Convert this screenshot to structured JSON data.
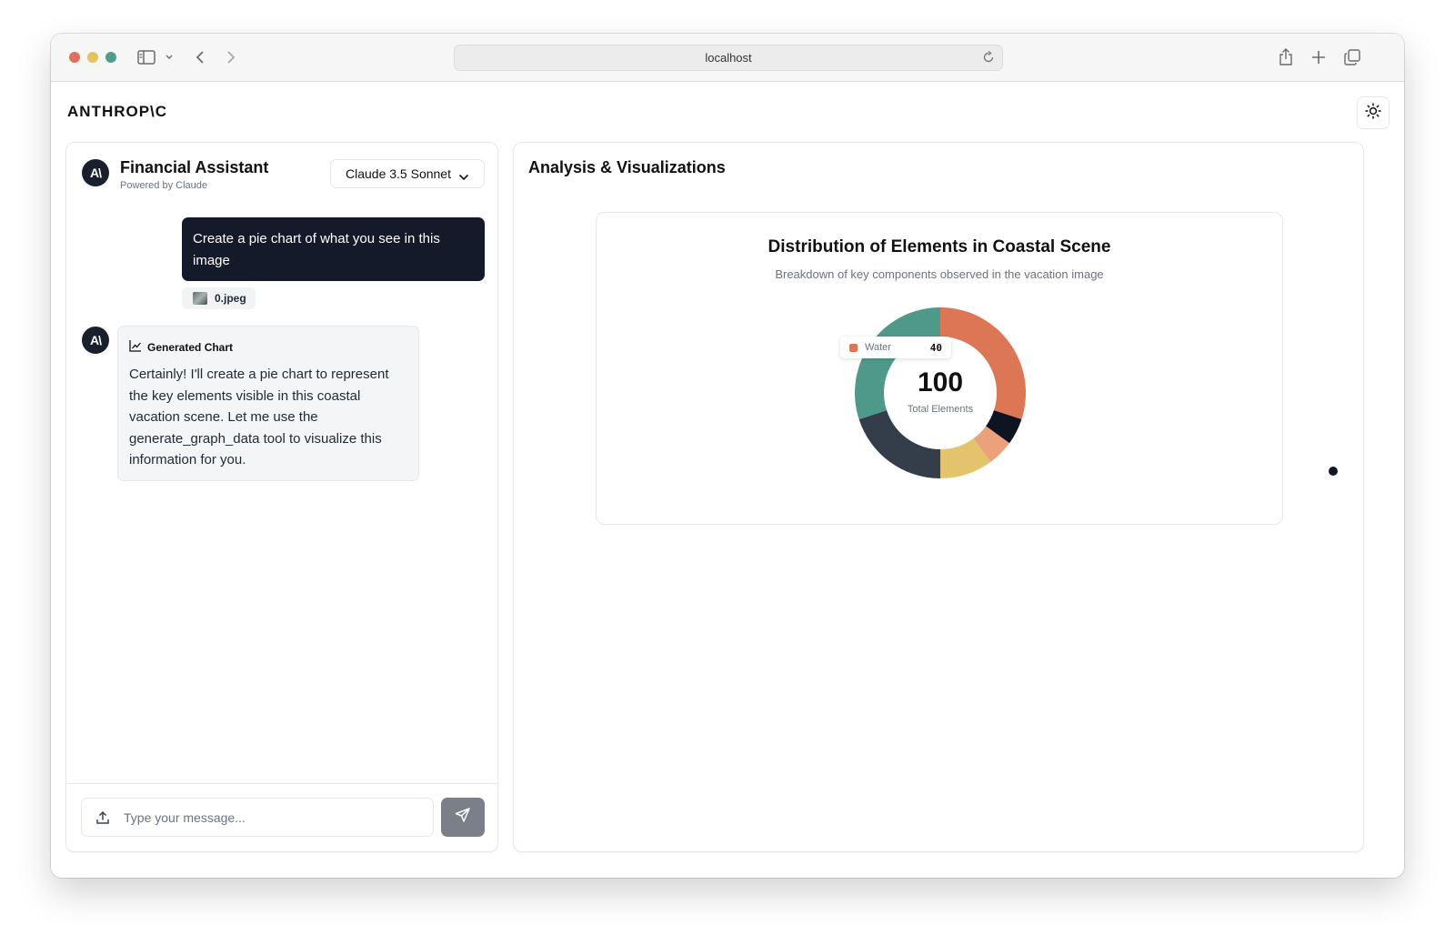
{
  "browser": {
    "url": "localhost"
  },
  "app": {
    "logo": "ANTHROP\\C"
  },
  "chat": {
    "avatar_text": "A\\",
    "title": "Financial Assistant",
    "subtitle": "Powered by Claude",
    "model": "Claude 3.5 Sonnet",
    "messages": [
      {
        "role": "user",
        "text": "Create a pie chart of what you see in this image",
        "attachment": "0.jpeg"
      },
      {
        "role": "assistant",
        "label": "Generated Chart",
        "text": "Certainly! I'll create a pie chart to represent the key elements visible in this coastal vacation scene. Let me use the generate_graph_data tool to visualize this information for you."
      }
    ],
    "input_placeholder": "Type your message..."
  },
  "viz": {
    "title": "Analysis & Visualizations",
    "tooltip": {
      "label": "Water",
      "value": "40"
    },
    "center_total": "100",
    "center_label": "Total Elements"
  },
  "chart_data": {
    "type": "pie",
    "title": "Distribution of Elements in Coastal Scene",
    "subtitle": "Breakdown of key components observed in the vacation image",
    "total": 100,
    "slices": [
      {
        "label": "Water",
        "value": 30,
        "color": "#dd7655"
      },
      {
        "value": 5,
        "color": "#0f1422"
      },
      {
        "value": 5,
        "color": "#eba27a"
      },
      {
        "value": 10,
        "color": "#e4c36d"
      },
      {
        "value": 20,
        "color": "#343e4a"
      },
      {
        "value": 30,
        "color": "#4f998b"
      }
    ]
  },
  "colors": {
    "accent_dark": "#141a29",
    "send_button": "#7a7f89"
  }
}
